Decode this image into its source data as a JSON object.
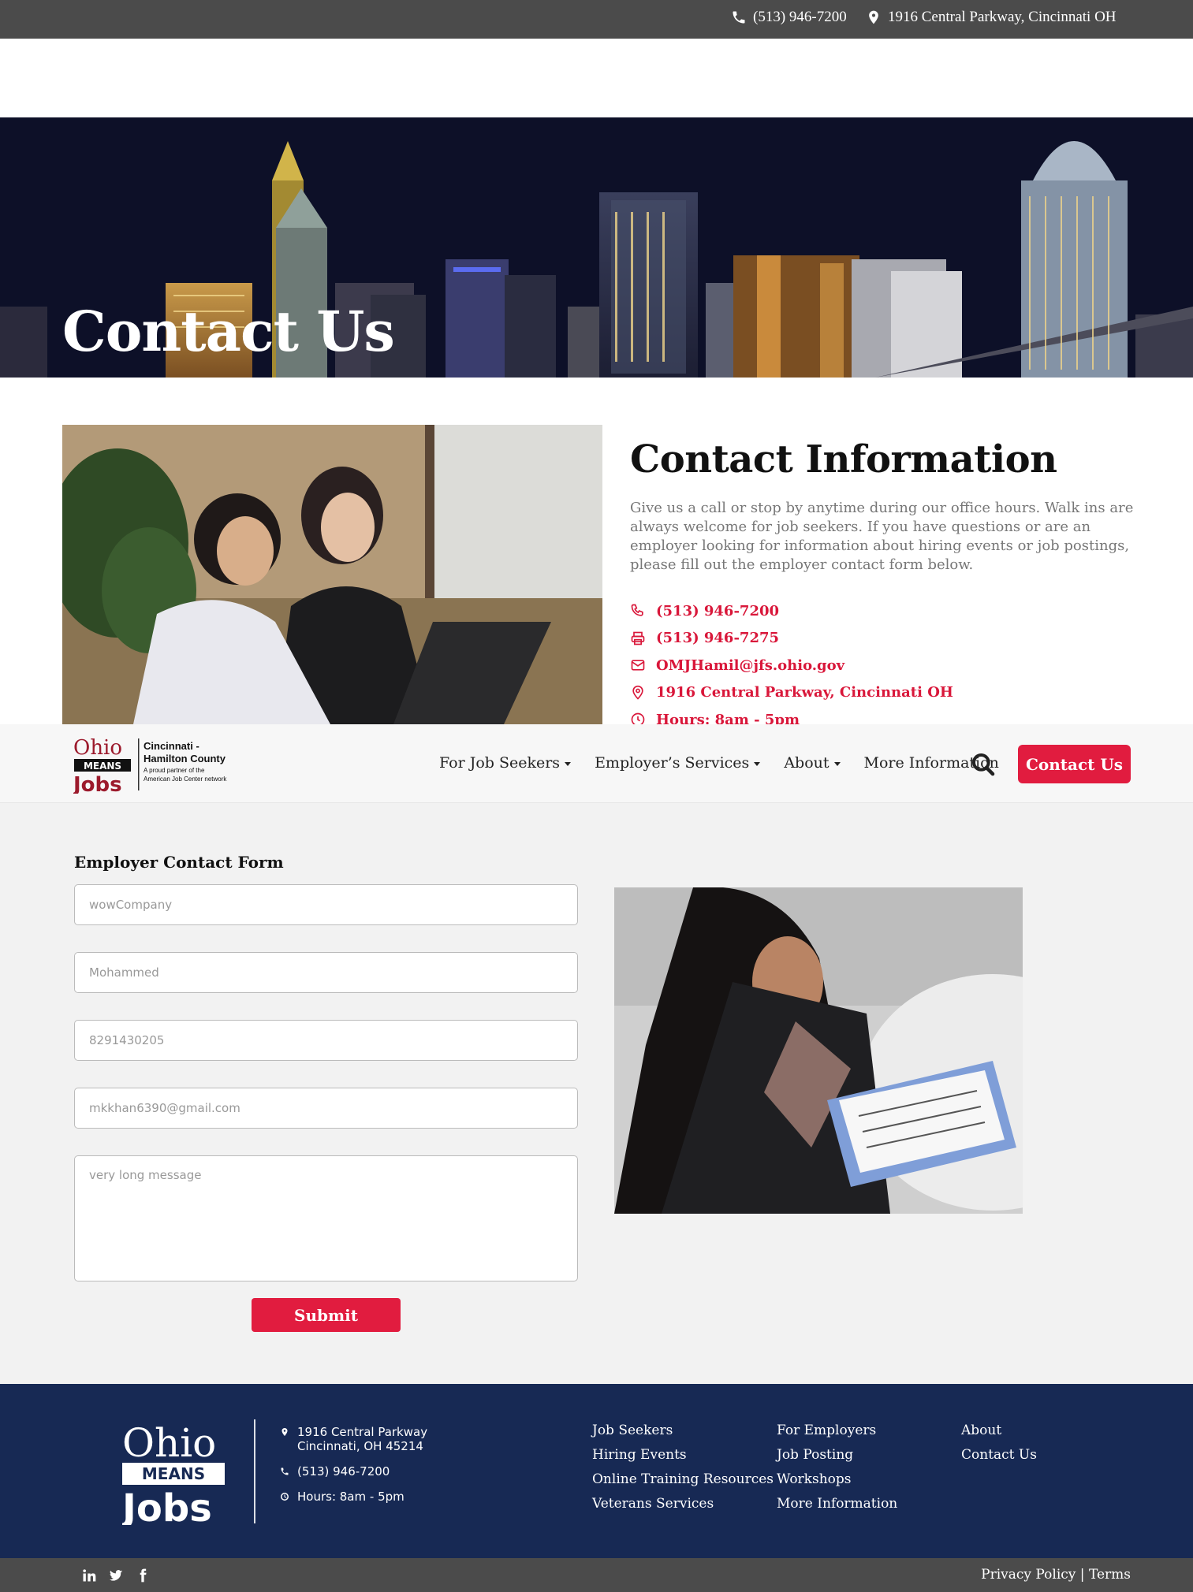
{
  "topbar": {
    "phone": "(513) 946-7200",
    "address": "1916 Central Parkway, Cincinnati OH"
  },
  "hero": {
    "title": "Contact Us"
  },
  "contact": {
    "heading": "Contact Information",
    "intro": "Give us a call or stop by anytime during our office hours. Walk ins are always welcome for job seekers. If you have questions or are an employer looking for information about hiring events or job postings, please fill out the employer contact form below.",
    "items": [
      {
        "icon": "phone-icon",
        "text": "(513) 946-7200"
      },
      {
        "icon": "printer-icon",
        "text": "(513) 946-7275"
      },
      {
        "icon": "mail-icon",
        "text": "OMJHamil@jfs.ohio.gov"
      },
      {
        "icon": "location-pin-icon",
        "text": "1916 Central Parkway, Cincinnati OH"
      },
      {
        "icon": "clock-icon",
        "text": "Hours: 8am - 5pm"
      }
    ]
  },
  "logo": {
    "ohio": "Ohio",
    "means": "MEANS",
    "jobs": "Jobs",
    "line1": "Cincinnati -",
    "line2": "Hamilton County",
    "line3": "A proud partner of the",
    "line4": "American Job Center network"
  },
  "nav": {
    "items": [
      "For Job Seekers",
      "Employer’s Services",
      "About",
      "More Information"
    ],
    "contact_button": "Contact Us"
  },
  "form": {
    "title": "Employer Contact Form",
    "company": "wowCompany",
    "name": "Mohammed",
    "phone": "8291430205",
    "email": "mkkhan6390@gmail.com",
    "message": "very long message",
    "submit": "Submit"
  },
  "footer": {
    "address_line1": "1916 Central Parkway",
    "address_line2": "Cincinnati, OH 45214",
    "phone": "(513) 946-7200",
    "hours": "Hours: 8am - 5pm",
    "col1": [
      "Job Seekers",
      "Hiring Events",
      "Online Training Resources",
      "Veterans Services"
    ],
    "col2": [
      "For Employers",
      "Job Posting",
      "Workshops",
      "More Information"
    ],
    "col3": [
      "About",
      "Contact Us"
    ],
    "privacy": "Privacy Policy",
    "separator": "|",
    "terms": "Terms",
    "social": [
      "linkedin-icon",
      "twitter-icon",
      "facebook-icon"
    ]
  },
  "colors": {
    "accent": "#e11c3f",
    "footer_bg": "#172954",
    "topbar_bg": "#4b4b4b"
  }
}
